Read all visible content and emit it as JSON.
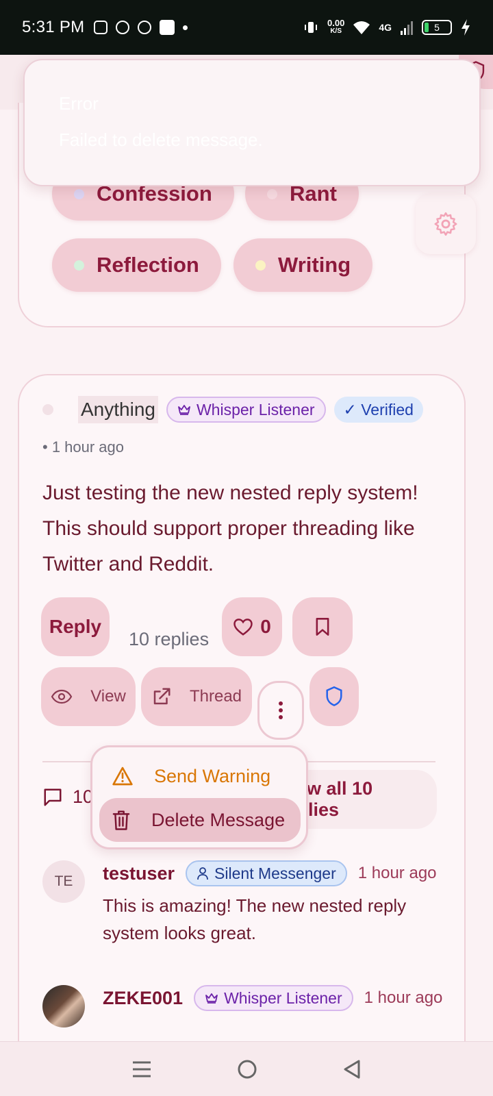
{
  "status_bar": {
    "time": "5:31 PM",
    "speed_value": "0.00",
    "speed_unit": "K/S",
    "network": "4G",
    "battery": "5"
  },
  "toast": {
    "title": "Error",
    "message": "Failed to delete message."
  },
  "categories": [
    {
      "label": "Confession",
      "dot_color": "#dcd6f5"
    },
    {
      "label": "Rant",
      "dot_color": "#f6dbe1"
    },
    {
      "label": "Reflection",
      "dot_color": "#d4f2dc"
    },
    {
      "label": "Writing",
      "dot_color": "#fbf3c2"
    }
  ],
  "post": {
    "author": "Anything",
    "badge_listener": "Whisper Listener",
    "badge_verified": "✓ Verified",
    "time": "• 1 hour ago",
    "body": "Just testing the new nested reply system! This should support proper threading like Twitter and Reddit.",
    "reply_label": "Reply",
    "replies_count": "10 replies",
    "likes": "0",
    "view_label": "View",
    "thread_label": "Thread",
    "comments_count": "10",
    "view_all_label": "View all 10 replies"
  },
  "menu": {
    "warn_label": "Send Warning",
    "delete_label": "Delete Message"
  },
  "replies": [
    {
      "initials": "TE",
      "name": "testuser",
      "badge": "Silent Messenger",
      "time": "1 hour ago",
      "text": "This is amazing! The new nested reply system looks great."
    },
    {
      "initials": "",
      "name": "ZEKE001",
      "badge": "Whisper Listener",
      "time": "1 hour ago",
      "text": ""
    }
  ],
  "colors": {
    "accent": "#8c1a3c",
    "chip_bg": "#f2ccd4",
    "warning": "#d97706",
    "shield": "#2563eb"
  }
}
